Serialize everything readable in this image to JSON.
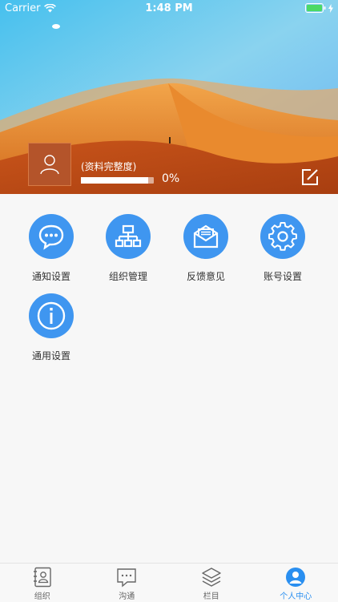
{
  "status_bar": {
    "carrier": "Carrier",
    "time": "1:48 PM"
  },
  "profile": {
    "completeness_label": "(资料完整度)",
    "progress_text": "0%",
    "progress_fraction": 0.92
  },
  "menu": [
    {
      "label": "通知设置",
      "icon": "chat-bubble-icon"
    },
    {
      "label": "组织管理",
      "icon": "org-chart-icon"
    },
    {
      "label": "反馈意见",
      "icon": "envelope-icon"
    },
    {
      "label": "账号设置",
      "icon": "gear-icon"
    },
    {
      "label": "通用设置",
      "icon": "info-icon"
    }
  ],
  "tabs": [
    {
      "label": "组织",
      "icon": "contacts-icon"
    },
    {
      "label": "沟通",
      "icon": "message-icon"
    },
    {
      "label": "栏目",
      "icon": "layers-icon"
    },
    {
      "label": "个人中心",
      "icon": "person-icon"
    }
  ],
  "colors": {
    "accent": "#3f96f0",
    "active_tab": "#2a8ff0"
  }
}
